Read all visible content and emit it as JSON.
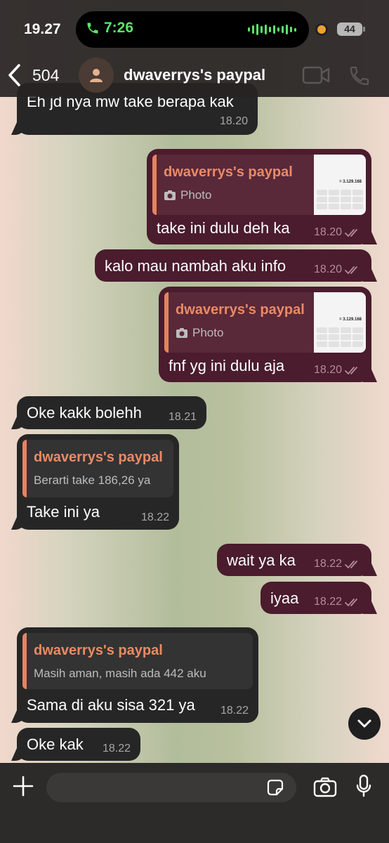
{
  "status": {
    "time": "19.27",
    "call_time": "7:26",
    "battery": "44"
  },
  "header": {
    "back_count": "504",
    "name": "dwaverrys's paypal"
  },
  "messages": [
    {
      "text": "Eh jd nya mw take berapa kak",
      "time": "18.20"
    },
    {
      "quote_name": "dwaverrys's paypal",
      "quote_text": "Photo",
      "thumb_value": "= 3.129.168",
      "text": "take ini dulu deh ka",
      "time": "18.20"
    },
    {
      "text": "kalo mau nambah aku info",
      "time": "18.20"
    },
    {
      "quote_name": "dwaverrys's paypal",
      "quote_text": "Photo",
      "thumb_value": "= 3.129.168",
      "text": "fnf yg ini dulu aja",
      "time": "18.20"
    },
    {
      "text": "Oke kakk bolehh",
      "time": "18.21"
    },
    {
      "quote_name": "dwaverrys's paypal",
      "quote_text": "Berarti take 186,26 ya",
      "text": "Take ini ya",
      "time": "18.22"
    },
    {
      "text": "wait ya ka",
      "time": "18.22"
    },
    {
      "text": "iyaa",
      "time": "18.22"
    },
    {
      "quote_name": "dwaverrys's paypal",
      "quote_text": "Masih aman, masih ada 442 aku",
      "text": "Sama di aku sisa 321 ya",
      "time": "18.22"
    },
    {
      "text": "Oke kak",
      "time": "18.22"
    }
  ],
  "composer": {
    "placeholder": ""
  },
  "colors": {
    "incoming": "#262626",
    "outgoing": "#4a1c2d",
    "quote_name": "#e98b66",
    "call_green": "#5ee36a"
  }
}
